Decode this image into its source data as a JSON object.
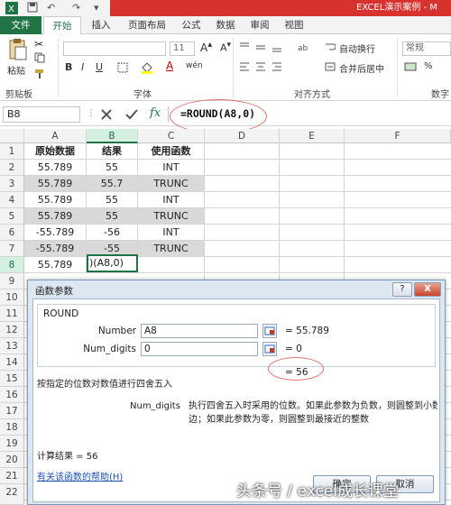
{
  "window": {
    "title": "EXCEL演示案例 - M"
  },
  "tabs": [
    {
      "label": "文件"
    },
    {
      "label": "开始"
    },
    {
      "label": "插入"
    },
    {
      "label": "页面布局"
    },
    {
      "label": "公式"
    },
    {
      "label": "数据"
    },
    {
      "label": "审阅"
    },
    {
      "label": "视图"
    }
  ],
  "ribbon": {
    "paste": "粘贴",
    "clipboard_group": "剪贴板",
    "font_size": "11",
    "font_group": "字体",
    "wrap_text": "自动换行",
    "merge_center": "合并后居中",
    "align_group": "对齐方式",
    "number_format": "常规",
    "number_group": "数字",
    "bold": "B",
    "italic": "I",
    "underline": "U",
    "font_color_letter": "A",
    "wen": "wén"
  },
  "formula_bar": {
    "name_box": "B8",
    "fx": "fx",
    "formula": "=ROUND(A8,0)"
  },
  "grid": {
    "columns": [
      "A",
      "B",
      "C",
      "D",
      "E",
      "F"
    ],
    "rows": [
      "1",
      "2",
      "3",
      "4",
      "5",
      "6",
      "7",
      "8",
      "9",
      "10",
      "11",
      "12",
      "13",
      "14",
      "15",
      "16",
      "17",
      "18",
      "19",
      "20",
      "21",
      "22"
    ],
    "header": [
      "原始数据",
      "结果",
      "使用函数"
    ],
    "data": [
      [
        "55.789",
        "55",
        "INT"
      ],
      [
        "55.789",
        "55.7",
        "TRUNC"
      ],
      [
        "55.789",
        "55",
        "INT"
      ],
      [
        "55.789",
        "55",
        "TRUNC"
      ],
      [
        "-55.789",
        "-56",
        "INT"
      ],
      [
        "-55.789",
        "-55",
        "TRUNC"
      ],
      [
        "55.789",
        ")(A8,0)",
        ""
      ]
    ]
  },
  "dialog": {
    "title": "函数参数",
    "help_btn": "?",
    "close_btn": "X",
    "func_name": "ROUND",
    "args": [
      {
        "label": "Number",
        "value": "A8",
        "result": "=  55.789"
      },
      {
        "label": "Num_digits",
        "value": "0",
        "result": "=  0"
      }
    ],
    "func_result": "=  56",
    "description": "按指定的位数对数值进行四舍五入",
    "param_name": "Num_digits",
    "param_desc_1": "执行四舍五入时采用的位数。如果此参数为负数，则圆整到小数点的左",
    "param_desc_2": "边；如果此参数为零，则圆整到最接近的整数",
    "calc_result": "计算结果 =   56",
    "help_link": "有关该函数的帮助(H)",
    "ok": "确定",
    "cancel": "取消"
  },
  "watermark": "头条号 / excel成长课堂"
}
